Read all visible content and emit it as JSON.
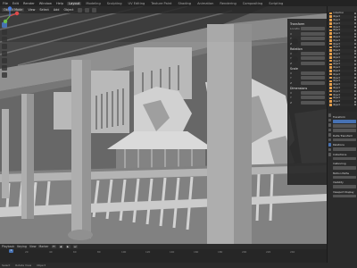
{
  "topbar": {
    "menus": [
      "File",
      "Edit",
      "Render",
      "Window",
      "Help"
    ],
    "workspaces": [
      "Layout",
      "Modeling",
      "Sculpting",
      "UV Editing",
      "Texture Paint",
      "Shading",
      "Animation",
      "Rendering",
      "Compositing",
      "Scripting"
    ],
    "active_workspace": "Layout"
  },
  "viewport": {
    "mode": "Object Mode",
    "menus": [
      "View",
      "Select",
      "Add",
      "Object"
    ],
    "shading": "solid",
    "scene_description_icon": "3d-scene"
  },
  "npanel": {
    "sections": [
      {
        "title": "Transform",
        "rows": [
          {
            "label": "Location",
            "value": ""
          },
          {
            "label": "X",
            "value": ""
          },
          {
            "label": "Y",
            "value": ""
          },
          {
            "label": "Z",
            "value": ""
          }
        ]
      },
      {
        "title": "Rotation",
        "rows": [
          {
            "label": "X",
            "value": ""
          },
          {
            "label": "Y",
            "value": ""
          },
          {
            "label": "Z",
            "value": ""
          }
        ]
      },
      {
        "title": "Scale",
        "rows": [
          {
            "label": "X",
            "value": ""
          },
          {
            "label": "Y",
            "value": ""
          },
          {
            "label": "Z",
            "value": ""
          }
        ]
      },
      {
        "title": "Dimensions",
        "rows": [
          {
            "label": "X",
            "value": ""
          },
          {
            "label": "Y",
            "value": ""
          },
          {
            "label": "Z",
            "value": ""
          }
        ]
      }
    ]
  },
  "timeline": {
    "menus": [
      "Playback",
      "Keying",
      "View",
      "Marker"
    ],
    "current_frame": "1",
    "ticks": [
      "0",
      "20",
      "40",
      "60",
      "80",
      "100",
      "120",
      "140",
      "160",
      "180",
      "200",
      "220",
      "240"
    ]
  },
  "statusbar": {
    "items": [
      "Select",
      "Rotate View",
      "Object"
    ]
  },
  "outliner": {
    "rows": [
      "Collection",
      "Object",
      "Object",
      "Object",
      "Object",
      "Object",
      "Object",
      "Object",
      "Object",
      "Object",
      "Object",
      "Object",
      "Object",
      "Object",
      "Object",
      "Object",
      "Object",
      "Object",
      "Object",
      "Object",
      "Object",
      "Object",
      "Object",
      "Object",
      "Object",
      "Object",
      "Object",
      "Object"
    ]
  },
  "properties": {
    "sections": [
      "Transform",
      "Delta Transform",
      "Relations",
      "Collections",
      "Instancing",
      "Motion Paths",
      "Visibility",
      "Viewport Display"
    ]
  },
  "colors": {
    "accent": "#4772b3",
    "panel_bg": "#282828",
    "viewport_bg": "#6a6a6a",
    "outliner_icon": "#e8a04b"
  }
}
